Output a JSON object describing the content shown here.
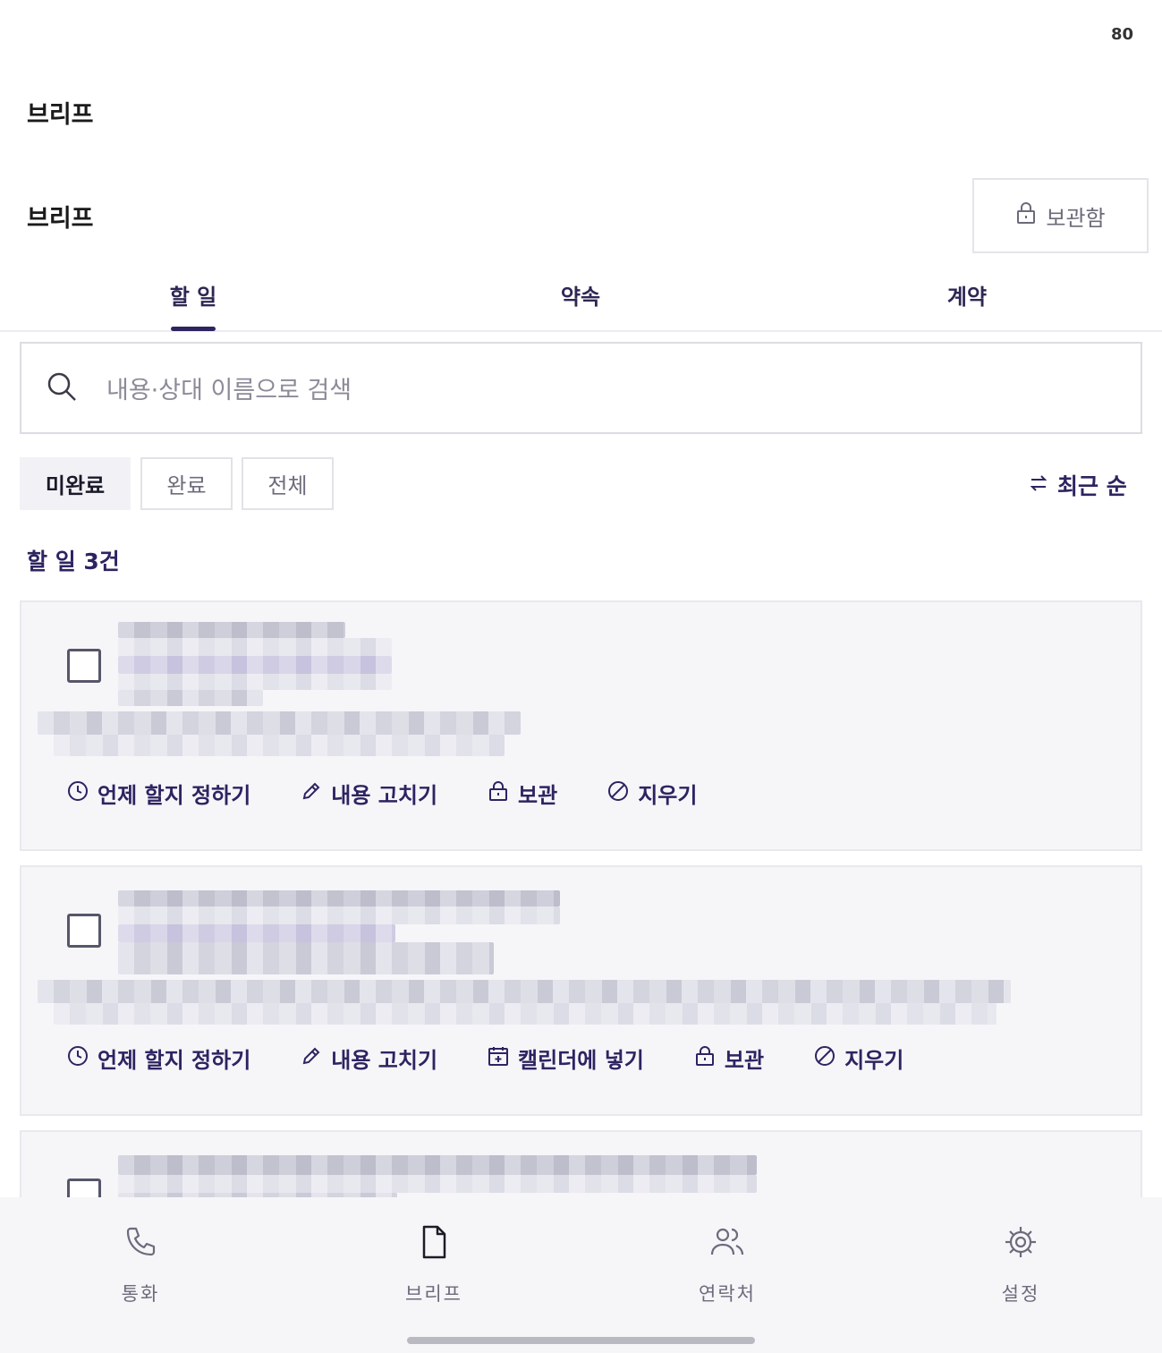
{
  "status": {
    "number": "80"
  },
  "header": {
    "title": "브리프"
  },
  "section": {
    "title": "브리프",
    "archive_label": "보관함"
  },
  "tabs": [
    {
      "label": "할 일",
      "active": true
    },
    {
      "label": "약속",
      "active": false
    },
    {
      "label": "계약",
      "active": false
    }
  ],
  "search": {
    "placeholder": "내용·상대 이름으로 검색"
  },
  "filters": [
    {
      "label": "미완료",
      "active": true
    },
    {
      "label": "완료",
      "active": false
    },
    {
      "label": "전체",
      "active": false
    }
  ],
  "sort": {
    "label": "최근 순",
    "icon": "swap-arrows-icon"
  },
  "list": {
    "count_label": "할 일 3건"
  },
  "cards": [
    {
      "actions": [
        {
          "label": "언제 할지 정하기",
          "icon": "clock-icon"
        },
        {
          "label": "내용 고치기",
          "icon": "pencil-icon"
        },
        {
          "label": "보관",
          "icon": "lock-icon"
        },
        {
          "label": "지우기",
          "icon": "block-icon"
        }
      ]
    },
    {
      "actions": [
        {
          "label": "언제 할지 정하기",
          "icon": "clock-icon"
        },
        {
          "label": "내용 고치기",
          "icon": "pencil-icon"
        },
        {
          "label": "캘린더에 넣기",
          "icon": "calendar-add-icon"
        },
        {
          "label": "보관",
          "icon": "lock-icon"
        },
        {
          "label": "지우기",
          "icon": "block-icon"
        }
      ]
    },
    {
      "actions": []
    }
  ],
  "bottom_nav": [
    {
      "label": "통화",
      "icon": "phone-icon"
    },
    {
      "label": "브리프",
      "icon": "document-icon"
    },
    {
      "label": "연락처",
      "icon": "people-icon"
    },
    {
      "label": "설정",
      "icon": "gear-icon"
    }
  ],
  "colors": {
    "accent": "#2d2461",
    "card_bg": "#f6f6f9",
    "muted_text": "#8b8b99"
  }
}
